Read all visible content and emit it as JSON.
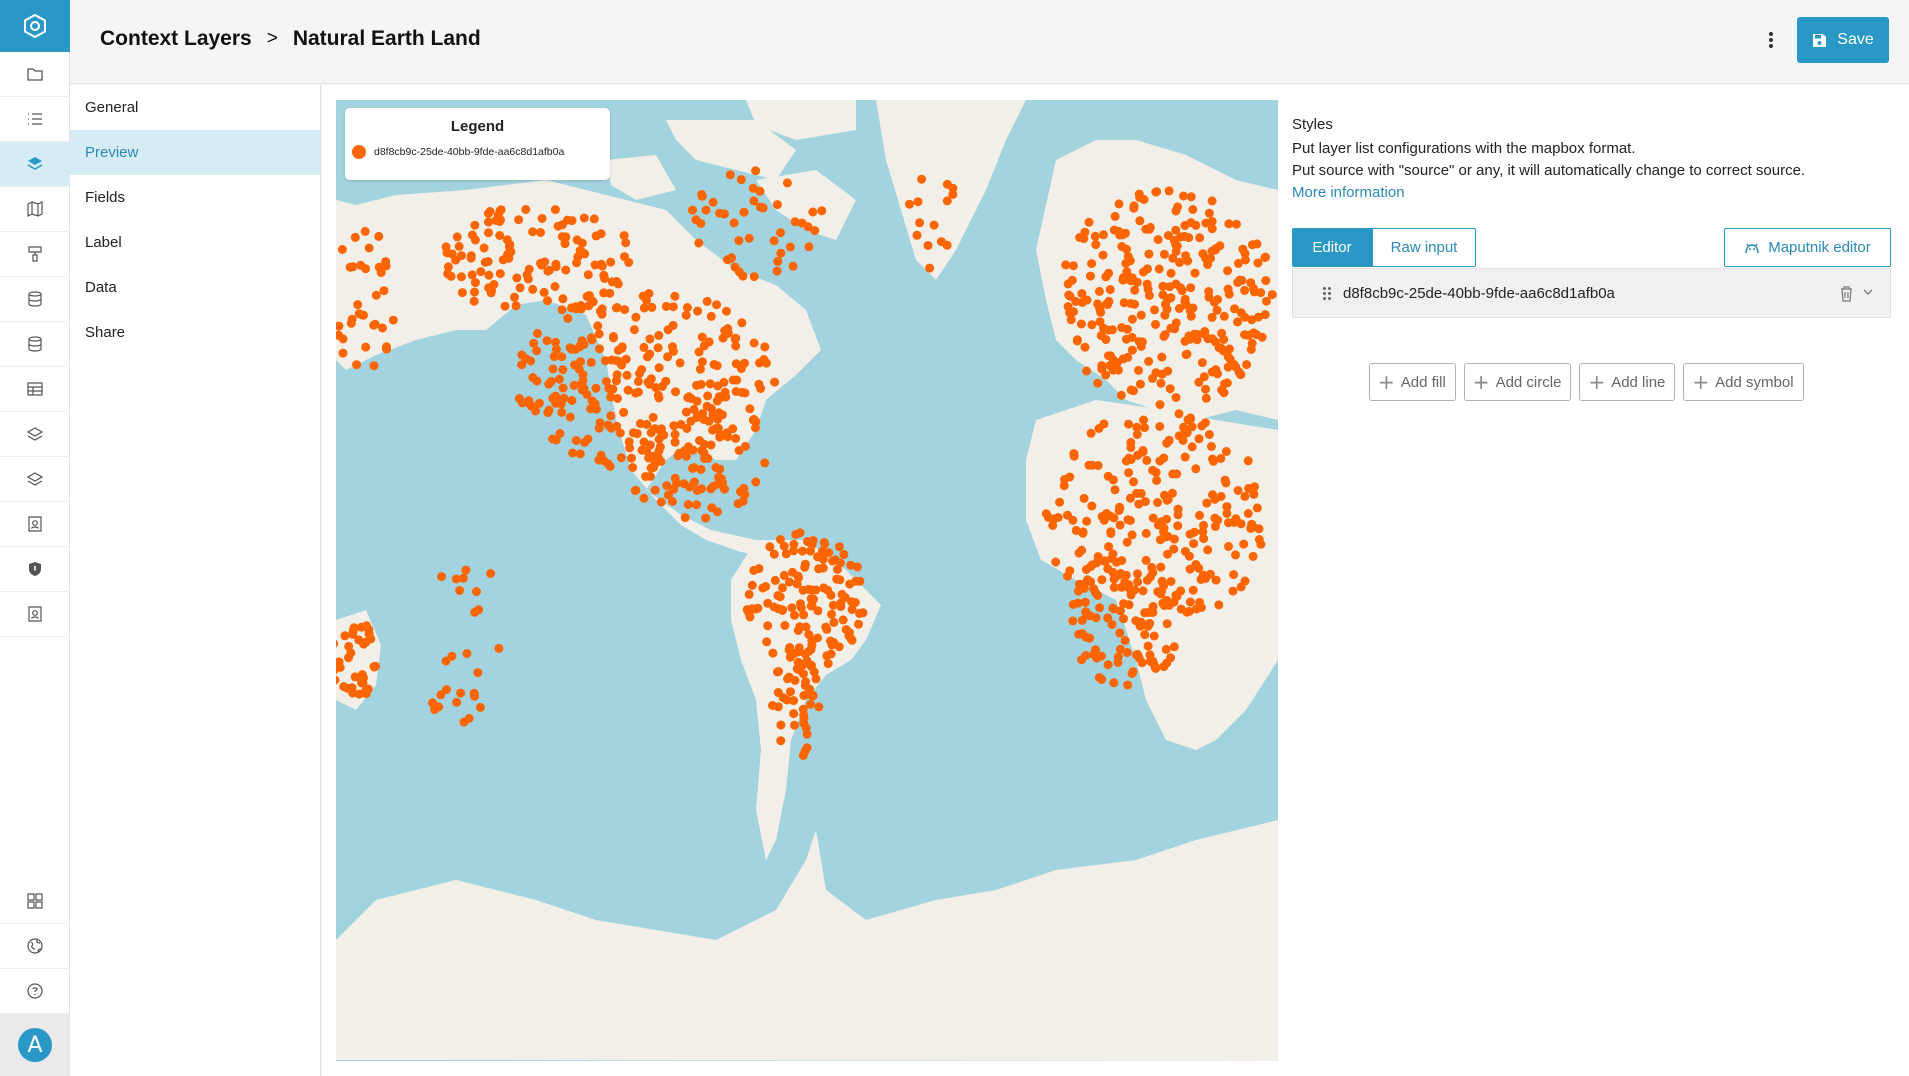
{
  "breadcrumb": {
    "parent": "Context Layers",
    "separator": ">",
    "current": "Natural Earth Land"
  },
  "header": {
    "save_label": "Save"
  },
  "subnav": {
    "items": [
      {
        "label": "General",
        "active": false
      },
      {
        "label": "Preview",
        "active": true
      },
      {
        "label": "Fields",
        "active": false
      },
      {
        "label": "Label",
        "active": false
      },
      {
        "label": "Data",
        "active": false
      },
      {
        "label": "Share",
        "active": false
      }
    ]
  },
  "rail": {
    "icons": [
      "folder-icon",
      "list-icon",
      "layers-icon",
      "map-icon",
      "paint-icon",
      "database-icon",
      "database-icon",
      "table-icon",
      "stack-icon",
      "stack-icon",
      "contact-icon",
      "shield-icon",
      "contact-icon"
    ],
    "active_index": 2,
    "bottom_icons": [
      "grid-icon",
      "globe-icon",
      "help-icon"
    ],
    "avatar_letter": "A"
  },
  "map": {
    "legend_title": "Legend",
    "legend_label": "d8f8cb9c-25de-40bb-9fde-aa6c8d1afb0a",
    "ocean_color": "#a3d3df",
    "land_color": "#f2efe9",
    "point_color": "#fc6500"
  },
  "styles": {
    "title": "Styles",
    "line1": "Put layer list configurations with the mapbox format.",
    "line2": "Put source with \"source\" or any, it will automatically change to correct source.",
    "more_link": "More information",
    "tab_editor": "Editor",
    "tab_raw": "Raw input",
    "maputnik_label": "Maputnik editor",
    "layer_name": "d8f8cb9c-25de-40bb-9fde-aa6c8d1afb0a",
    "add_buttons": [
      "Add fill",
      "Add circle",
      "Add line",
      "Add symbol"
    ]
  },
  "colors": {
    "accent": "#2a98c6",
    "active_bg": "#d6ecf5"
  }
}
